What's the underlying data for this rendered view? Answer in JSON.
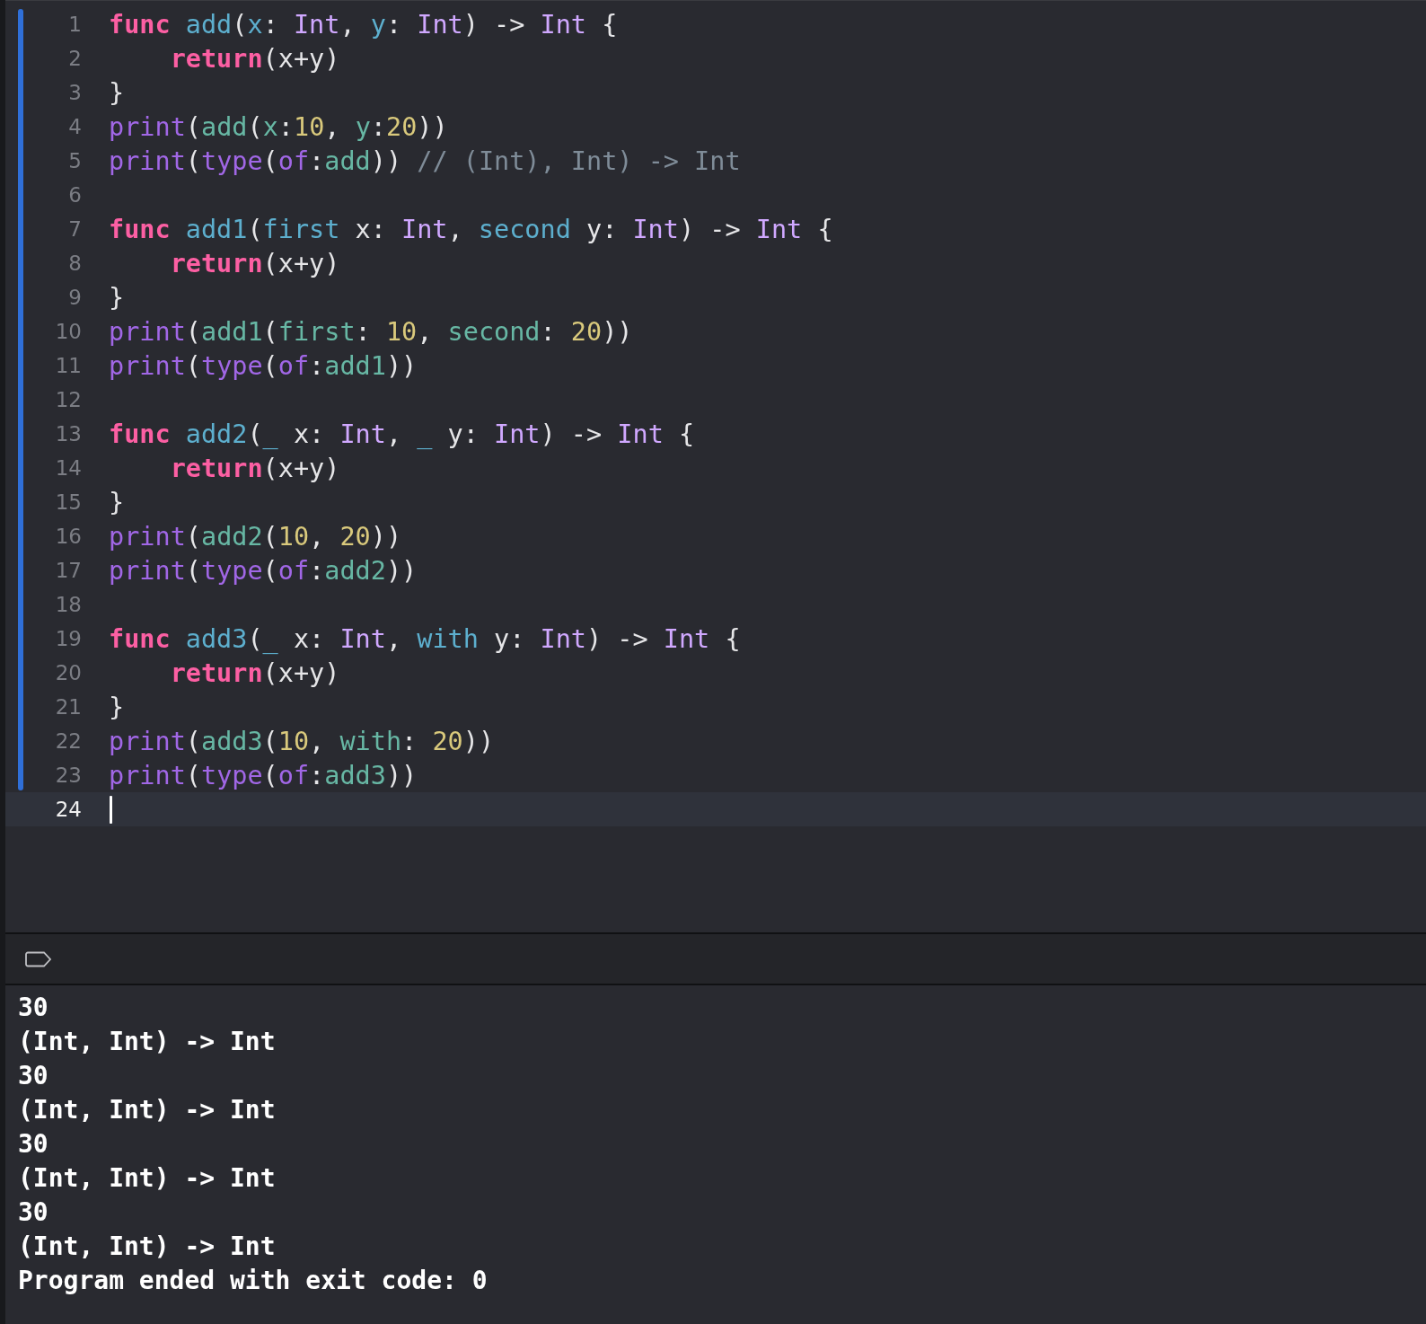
{
  "editor": {
    "lines": [
      {
        "number": "1",
        "changed": true,
        "current": false,
        "tokens": [
          {
            "text": "func ",
            "kind": "keyword"
          },
          {
            "text": "add",
            "kind": "declaration"
          },
          {
            "text": "(",
            "kind": "plain"
          },
          {
            "text": "x",
            "kind": "declaration"
          },
          {
            "text": ": ",
            "kind": "plain"
          },
          {
            "text": "Int",
            "kind": "type"
          },
          {
            "text": ", ",
            "kind": "plain"
          },
          {
            "text": "y",
            "kind": "declaration"
          },
          {
            "text": ": ",
            "kind": "plain"
          },
          {
            "text": "Int",
            "kind": "type"
          },
          {
            "text": ") -> ",
            "kind": "plain"
          },
          {
            "text": "Int",
            "kind": "type"
          },
          {
            "text": " {",
            "kind": "plain"
          }
        ]
      },
      {
        "number": "2",
        "changed": true,
        "current": false,
        "tokens": [
          {
            "text": "    return",
            "kind": "keyword"
          },
          {
            "text": "(x+y)",
            "kind": "plain"
          }
        ]
      },
      {
        "number": "3",
        "changed": true,
        "current": false,
        "tokens": [
          {
            "text": "}",
            "kind": "plain"
          }
        ]
      },
      {
        "number": "4",
        "changed": true,
        "current": false,
        "tokens": [
          {
            "text": "print",
            "kind": "library"
          },
          {
            "text": "(",
            "kind": "plain"
          },
          {
            "text": "add",
            "kind": "project"
          },
          {
            "text": "(",
            "kind": "plain"
          },
          {
            "text": "x",
            "kind": "project"
          },
          {
            "text": ":",
            "kind": "plain"
          },
          {
            "text": "10",
            "kind": "number"
          },
          {
            "text": ", ",
            "kind": "plain"
          },
          {
            "text": "y",
            "kind": "project"
          },
          {
            "text": ":",
            "kind": "plain"
          },
          {
            "text": "20",
            "kind": "number"
          },
          {
            "text": "))",
            "kind": "plain"
          }
        ]
      },
      {
        "number": "5",
        "changed": true,
        "current": false,
        "tokens": [
          {
            "text": "print",
            "kind": "library"
          },
          {
            "text": "(",
            "kind": "plain"
          },
          {
            "text": "type",
            "kind": "library"
          },
          {
            "text": "(",
            "kind": "plain"
          },
          {
            "text": "of",
            "kind": "library"
          },
          {
            "text": ":",
            "kind": "plain"
          },
          {
            "text": "add",
            "kind": "project"
          },
          {
            "text": ")) ",
            "kind": "plain"
          },
          {
            "text": "// (Int), Int) -> Int",
            "kind": "comment"
          }
        ]
      },
      {
        "number": "6",
        "changed": true,
        "current": false
      },
      {
        "number": "7",
        "changed": true,
        "current": false,
        "tokens": [
          {
            "text": "func ",
            "kind": "keyword"
          },
          {
            "text": "add1",
            "kind": "declaration"
          },
          {
            "text": "(",
            "kind": "plain"
          },
          {
            "text": "first",
            "kind": "declaration"
          },
          {
            "text": " x: ",
            "kind": "plain"
          },
          {
            "text": "Int",
            "kind": "type"
          },
          {
            "text": ", ",
            "kind": "plain"
          },
          {
            "text": "second",
            "kind": "declaration"
          },
          {
            "text": " y: ",
            "kind": "plain"
          },
          {
            "text": "Int",
            "kind": "type"
          },
          {
            "text": ") -> ",
            "kind": "plain"
          },
          {
            "text": "Int",
            "kind": "type"
          },
          {
            "text": " {",
            "kind": "plain"
          }
        ]
      },
      {
        "number": "8",
        "changed": true,
        "current": false,
        "tokens": [
          {
            "text": "    return",
            "kind": "keyword"
          },
          {
            "text": "(x+y)",
            "kind": "plain"
          }
        ]
      },
      {
        "number": "9",
        "changed": true,
        "current": false,
        "tokens": [
          {
            "text": "}",
            "kind": "plain"
          }
        ]
      },
      {
        "number": "10",
        "changed": true,
        "current": false,
        "tokens": [
          {
            "text": "print",
            "kind": "library"
          },
          {
            "text": "(",
            "kind": "plain"
          },
          {
            "text": "add1",
            "kind": "project"
          },
          {
            "text": "(",
            "kind": "plain"
          },
          {
            "text": "first",
            "kind": "project"
          },
          {
            "text": ": ",
            "kind": "plain"
          },
          {
            "text": "10",
            "kind": "number"
          },
          {
            "text": ", ",
            "kind": "plain"
          },
          {
            "text": "second",
            "kind": "project"
          },
          {
            "text": ": ",
            "kind": "plain"
          },
          {
            "text": "20",
            "kind": "number"
          },
          {
            "text": "))",
            "kind": "plain"
          }
        ]
      },
      {
        "number": "11",
        "changed": true,
        "current": false,
        "tokens": [
          {
            "text": "print",
            "kind": "library"
          },
          {
            "text": "(",
            "kind": "plain"
          },
          {
            "text": "type",
            "kind": "library"
          },
          {
            "text": "(",
            "kind": "plain"
          },
          {
            "text": "of",
            "kind": "library"
          },
          {
            "text": ":",
            "kind": "plain"
          },
          {
            "text": "add1",
            "kind": "project"
          },
          {
            "text": "))",
            "kind": "plain"
          }
        ]
      },
      {
        "number": "12",
        "changed": true,
        "current": false
      },
      {
        "number": "13",
        "changed": true,
        "current": false,
        "tokens": [
          {
            "text": "func ",
            "kind": "keyword"
          },
          {
            "text": "add2",
            "kind": "declaration"
          },
          {
            "text": "(",
            "kind": "plain"
          },
          {
            "text": "_",
            "kind": "declaration"
          },
          {
            "text": " x: ",
            "kind": "plain"
          },
          {
            "text": "Int",
            "kind": "type"
          },
          {
            "text": ", ",
            "kind": "plain"
          },
          {
            "text": "_",
            "kind": "declaration"
          },
          {
            "text": " y: ",
            "kind": "plain"
          },
          {
            "text": "Int",
            "kind": "type"
          },
          {
            "text": ") -> ",
            "kind": "plain"
          },
          {
            "text": "Int",
            "kind": "type"
          },
          {
            "text": " {",
            "kind": "plain"
          }
        ]
      },
      {
        "number": "14",
        "changed": true,
        "current": false,
        "tokens": [
          {
            "text": "    return",
            "kind": "keyword"
          },
          {
            "text": "(x+y)",
            "kind": "plain"
          }
        ]
      },
      {
        "number": "15",
        "changed": true,
        "current": false,
        "tokens": [
          {
            "text": "}",
            "kind": "plain"
          }
        ]
      },
      {
        "number": "16",
        "changed": true,
        "current": false,
        "tokens": [
          {
            "text": "print",
            "kind": "library"
          },
          {
            "text": "(",
            "kind": "plain"
          },
          {
            "text": "add2",
            "kind": "project"
          },
          {
            "text": "(",
            "kind": "plain"
          },
          {
            "text": "10",
            "kind": "number"
          },
          {
            "text": ", ",
            "kind": "plain"
          },
          {
            "text": "20",
            "kind": "number"
          },
          {
            "text": "))",
            "kind": "plain"
          }
        ]
      },
      {
        "number": "17",
        "changed": true,
        "current": false,
        "tokens": [
          {
            "text": "print",
            "kind": "library"
          },
          {
            "text": "(",
            "kind": "plain"
          },
          {
            "text": "type",
            "kind": "library"
          },
          {
            "text": "(",
            "kind": "plain"
          },
          {
            "text": "of",
            "kind": "library"
          },
          {
            "text": ":",
            "kind": "plain"
          },
          {
            "text": "add2",
            "kind": "project"
          },
          {
            "text": "))",
            "kind": "plain"
          }
        ]
      },
      {
        "number": "18",
        "changed": true,
        "current": false
      },
      {
        "number": "19",
        "changed": true,
        "current": false,
        "tokens": [
          {
            "text": "func ",
            "kind": "keyword"
          },
          {
            "text": "add3",
            "kind": "declaration"
          },
          {
            "text": "(",
            "kind": "plain"
          },
          {
            "text": "_",
            "kind": "declaration"
          },
          {
            "text": " x: ",
            "kind": "plain"
          },
          {
            "text": "Int",
            "kind": "type"
          },
          {
            "text": ", ",
            "kind": "plain"
          },
          {
            "text": "with",
            "kind": "declaration"
          },
          {
            "text": " y: ",
            "kind": "plain"
          },
          {
            "text": "Int",
            "kind": "type"
          },
          {
            "text": ") -> ",
            "kind": "plain"
          },
          {
            "text": "Int",
            "kind": "type"
          },
          {
            "text": " {",
            "kind": "plain"
          }
        ]
      },
      {
        "number": "20",
        "changed": true,
        "current": false,
        "tokens": [
          {
            "text": "    return",
            "kind": "keyword"
          },
          {
            "text": "(x+y)",
            "kind": "plain"
          }
        ]
      },
      {
        "number": "21",
        "changed": true,
        "current": false,
        "tokens": [
          {
            "text": "}",
            "kind": "plain"
          }
        ]
      },
      {
        "number": "22",
        "changed": true,
        "current": false,
        "tokens": [
          {
            "text": "print",
            "kind": "library"
          },
          {
            "text": "(",
            "kind": "plain"
          },
          {
            "text": "add3",
            "kind": "project"
          },
          {
            "text": "(",
            "kind": "plain"
          },
          {
            "text": "10",
            "kind": "number"
          },
          {
            "text": ", ",
            "kind": "plain"
          },
          {
            "text": "with",
            "kind": "project"
          },
          {
            "text": ": ",
            "kind": "plain"
          },
          {
            "text": "20",
            "kind": "number"
          },
          {
            "text": "))",
            "kind": "plain"
          }
        ]
      },
      {
        "number": "23",
        "changed": true,
        "current": false,
        "tokens": [
          {
            "text": "print",
            "kind": "library"
          },
          {
            "text": "(",
            "kind": "plain"
          },
          {
            "text": "type",
            "kind": "library"
          },
          {
            "text": "(",
            "kind": "plain"
          },
          {
            "text": "of",
            "kind": "library"
          },
          {
            "text": ":",
            "kind": "plain"
          },
          {
            "text": "add3",
            "kind": "project"
          },
          {
            "text": "))",
            "kind": "plain"
          }
        ]
      },
      {
        "number": "24",
        "changed": false,
        "current": true
      }
    ]
  },
  "console": {
    "output": [
      "30",
      "(Int, Int) -> Int",
      "30",
      "(Int, Int) -> Int",
      "30",
      "(Int, Int) -> Int",
      "30",
      "(Int, Int) -> Int",
      "Program ended with exit code: 0"
    ]
  }
}
